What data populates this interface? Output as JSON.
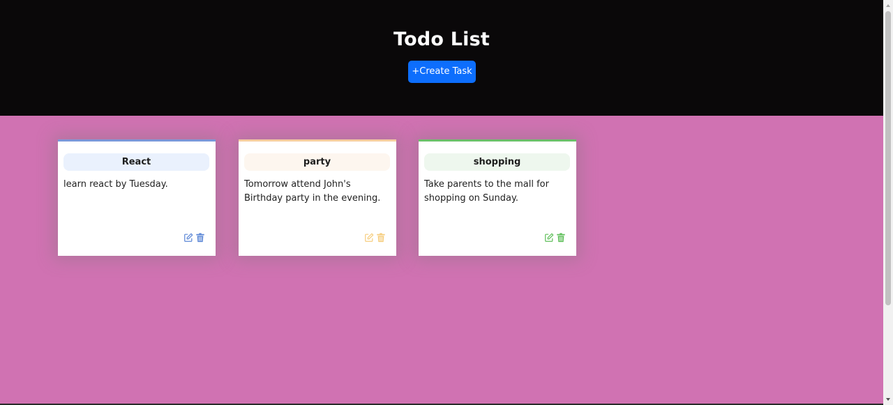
{
  "header": {
    "title": "Todo List",
    "create_button_label": "+Create Task"
  },
  "colors": {
    "header_bg": "#0a0809",
    "page_bg": "#d072b2",
    "button": "#0d6efd"
  },
  "tasks": [
    {
      "name": "React",
      "description": "learn react by Tuesday.",
      "accent": "#5b86d6",
      "icons": [
        "edit-icon",
        "trash-icon"
      ]
    },
    {
      "name": "party",
      "description": "Tomorrow attend John's Birthday party in the evening.",
      "accent": "#f6cd7e",
      "icons": [
        "edit-icon",
        "trash-icon"
      ]
    },
    {
      "name": "shopping",
      "description": "Take parents to the mall for shopping on Sunday.",
      "accent": "#5fbf5a",
      "icons": [
        "edit-icon",
        "trash-icon"
      ]
    }
  ]
}
